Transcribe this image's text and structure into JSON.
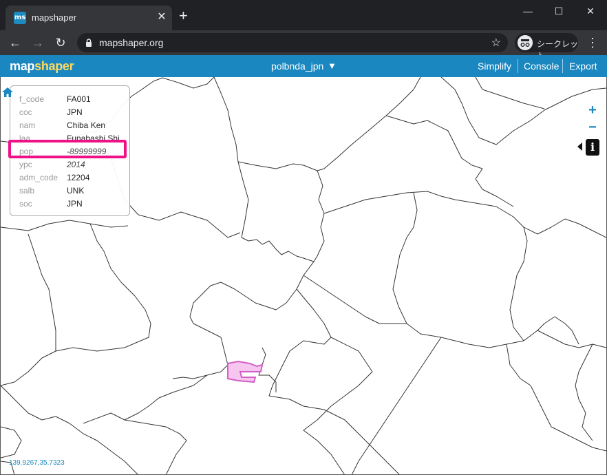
{
  "browser": {
    "tab_title": "mapshaper",
    "favicon_text": "ms",
    "url": "mapshaper.org",
    "incognito_label": "シークレット",
    "close_glyph": "✕",
    "new_tab_glyph": "+",
    "minimize_glyph": "—",
    "maximize_glyph": "☐",
    "window_close_glyph": "✕",
    "back_glyph": "←",
    "forward_glyph": "→",
    "reload_glyph": "↻",
    "star_glyph": "☆",
    "menu_glyph": "⋮"
  },
  "app": {
    "logo_a": "map",
    "logo_b": "shaper",
    "layer_name": "polbnda_jpn",
    "layer_caret": "▼",
    "menu": [
      "Simplify",
      "Console",
      "Export"
    ]
  },
  "popup": {
    "rows": [
      {
        "key": "f_code",
        "value": "FA001",
        "italic": false
      },
      {
        "key": "coc",
        "value": "JPN",
        "italic": false
      },
      {
        "key": "nam",
        "value": "Chiba Ken",
        "italic": false
      },
      {
        "key": "laa",
        "value": "Funabashi Shi",
        "italic": false
      },
      {
        "key": "pop",
        "value": "-89999999",
        "italic": true
      },
      {
        "key": "ypc",
        "value": "2014",
        "italic": true
      },
      {
        "key": "adm_code",
        "value": "12204",
        "italic": false
      },
      {
        "key": "salb",
        "value": "UNK",
        "italic": false
      },
      {
        "key": "soc",
        "value": "JPN",
        "italic": false
      }
    ]
  },
  "map_controls": {
    "home_glyph": "⌂",
    "zoom_in_glyph": "+",
    "zoom_out_glyph": "−",
    "info_glyph": "i"
  },
  "coords": "139.9267,35.7323",
  "colors": {
    "appbar": "#1a87c0",
    "highlight": "#ee1289",
    "selection_fill": "#f7c6ee",
    "selection_stroke": "#d35ec7"
  }
}
